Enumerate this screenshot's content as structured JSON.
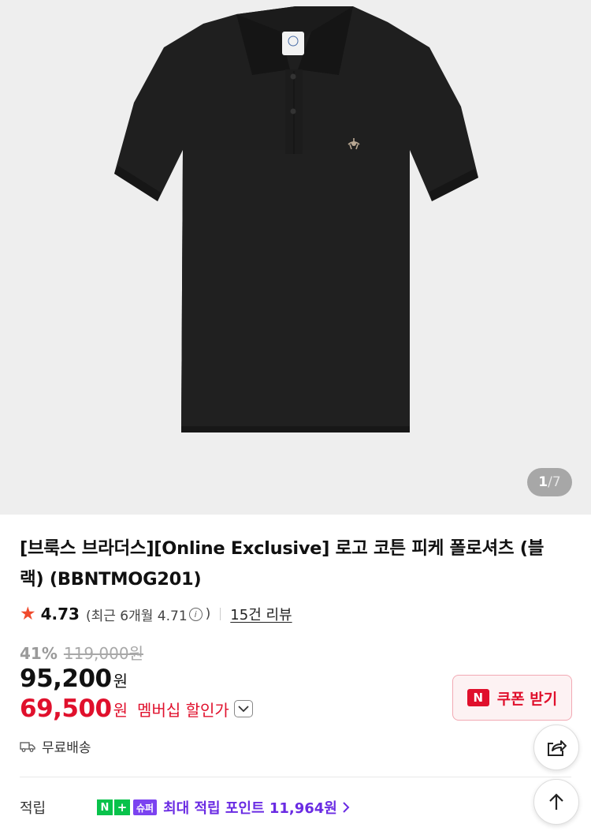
{
  "gallery": {
    "current": "1",
    "separator": "/",
    "total": "7"
  },
  "product": {
    "title": "[브룩스 브라더스][Online Exclusive] 로고 코튼 피케 폴로셔츠 (블랙) (BBNTMOG201)"
  },
  "rating": {
    "star": "★",
    "score": "4.73",
    "recent_prefix": "(최근 6개월 4.71",
    "info_icon": "i",
    "recent_suffix": ")",
    "review_count": "15건 리뷰"
  },
  "price": {
    "discount_rate": "41%",
    "original": "119,000원",
    "sale": "95,200",
    "sale_unit": "원",
    "member": "69,500",
    "member_unit": "원",
    "member_label": "멤버십 할인가"
  },
  "coupon": {
    "label": "쿠폰 받기",
    "logo": "N"
  },
  "shipping": {
    "label": "무료배송"
  },
  "points": {
    "label": "적립",
    "badge_n": "N",
    "badge_plus": "+",
    "badge_super": "슈퍼",
    "text": "최대 적립 포인트 11,964원"
  },
  "icons": {
    "dropdown": "chevron-down-icon",
    "truck": "truck-icon",
    "share": "share-icon",
    "scroll_top": "arrow-up-icon",
    "points_chevron": "chevron-right-icon"
  },
  "colors": {
    "accent_red": "#e0102c",
    "points_purple": "#6a2be3",
    "naver_green": "#08c24b",
    "star": "#f04a2d"
  }
}
